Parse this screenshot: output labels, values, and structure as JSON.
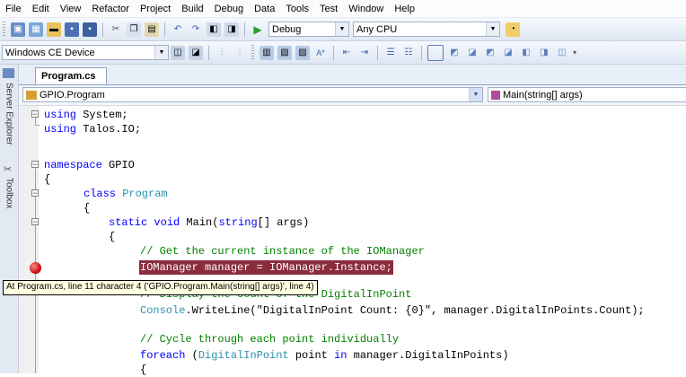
{
  "menu": [
    "File",
    "Edit",
    "View",
    "Refactor",
    "Project",
    "Build",
    "Debug",
    "Data",
    "Tools",
    "Test",
    "Window",
    "Help"
  ],
  "toolbar1": {
    "config": "Debug",
    "platform": "Any CPU"
  },
  "toolbar2": {
    "device": "Windows CE Device"
  },
  "side_tabs": {
    "server_explorer": "Server Explorer",
    "toolbox": "Toolbox"
  },
  "document_tab": "Program.cs",
  "navbar": {
    "class_combo": "GPIO.Program",
    "member_combo": "Main(string[] args)"
  },
  "code": {
    "l1_kw": "using",
    "l1_rest": " System;",
    "l2_kw": "using",
    "l2_rest": " Talos.IO;",
    "l3_kw": "namespace",
    "l3_rest": " GPIO",
    "brace_open": "{",
    "l5_kw": "class",
    "l5_type": "Program",
    "l7_kw1": "static",
    "l7_kw2": "void",
    "l7_rest": " Main(",
    "l7_kw3": "string",
    "l7_rest2": "[] args)",
    "l9_comment": "// Get the current instance of the IOManager",
    "l10_highlight": "IOManager manager = IOManager.Instance;",
    "l11_comment": "// Display the count of the DigitalInPoint",
    "l12_type": "Console",
    "l12_rest": ".WriteLine(\"DigitalInPoint Count: {0}\", manager.DigitalInPoints.Count);",
    "l14_comment": "// Cycle through each point individually",
    "l15_kw1": "foreach",
    "l15_rest1": " (",
    "l15_type": "DigitalInPoint",
    "l15_rest2": " point ",
    "l15_kw2": "in",
    "l15_rest3": " manager.DigitalInPoints)"
  },
  "tooltip": "At Program.cs, line 11 character 4 ('GPIO.Program.Main(string[] args)', line 4)",
  "colors": {
    "highlight": "#8b2c3c",
    "keyword": "#0000ff",
    "type": "#2b91af",
    "comment": "#008000",
    "breakpoint": "#c00000"
  }
}
